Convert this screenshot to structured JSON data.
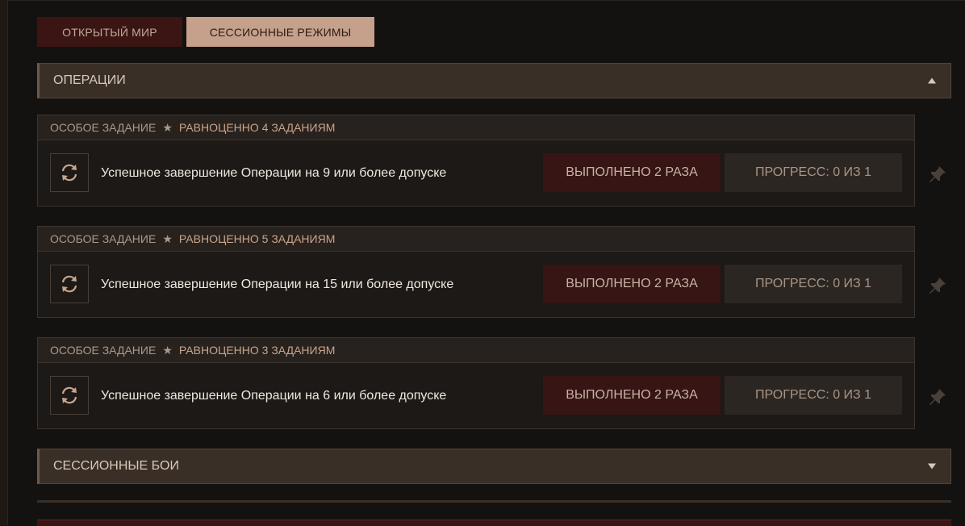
{
  "tabs": {
    "open_world": "ОТКРЫТЫЙ МИР",
    "session_modes": "СЕССИОННЫЕ РЕЖИМЫ"
  },
  "sections": {
    "operations": {
      "title": "ОПЕРАЦИИ",
      "expanded": true
    },
    "session_battles": {
      "title": "СЕССИОННЫЕ БОИ",
      "expanded": false
    }
  },
  "tasks": [
    {
      "type": "ОСОБОЕ ЗАДАНИЕ",
      "equivalent": "РАВНОЦЕННО 4 ЗАДАНИЯМ",
      "description": "Успешное завершение Операции на 9 или более допуске",
      "completed": "ВЫПОЛНЕНО 2 РАЗА",
      "progress": "ПРОГРЕСС: 0 ИЗ 1"
    },
    {
      "type": "ОСОБОЕ ЗАДАНИЕ",
      "equivalent": "РАВНОЦЕННО 5 ЗАДАНИЯМ",
      "description": "Успешное завершение Операции на 15 или более допуске",
      "completed": "ВЫПОЛНЕНО 2 РАЗА",
      "progress": "ПРОГРЕСС: 0 ИЗ 1"
    },
    {
      "type": "ОСОБОЕ ЗАДАНИЕ",
      "equivalent": "РАВНОЦЕННО 3 ЗАДАНИЯМ",
      "description": "Успешное завершение Операции на 6 или более допуске",
      "completed": "ВЫПОЛНЕНО 2 РАЗА",
      "progress": "ПРОГРЕСС: 0 ИЗ 1"
    }
  ],
  "icons": {
    "star": "star-icon",
    "refresh": "refresh-icon",
    "pin": "pin-icon",
    "expand_up": "chevron-up-icon",
    "expand_down": "chevron-down-icon"
  },
  "colors": {
    "background": "#141210",
    "active_tab": "#c5a08a",
    "inactive_tab": "#3a1513",
    "section_header": "#3a2f27",
    "completed_badge": "#361514",
    "progress_badge": "#2c2622",
    "accent_text": "#c8a58c"
  }
}
